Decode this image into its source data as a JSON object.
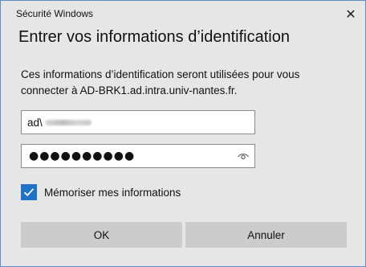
{
  "window": {
    "title": "Sécurité Windows",
    "close_glyph": "✕"
  },
  "dialog": {
    "heading": "Entrer vos informations d’identification",
    "description": "Ces informations d’identification seront utilisées pour vous connecter à AD-BRK1.ad.intra.univ-nantes.fr."
  },
  "username_field": {
    "value_prefix": "ad\\",
    "value_obscured": true
  },
  "password_field": {
    "masked_value": "●●●●●●●●●●",
    "reveal_icon": "eye-icon"
  },
  "remember_checkbox": {
    "label": "Mémoriser mes informations",
    "checked": true
  },
  "buttons": {
    "ok_label": "OK",
    "cancel_label": "Annuler"
  },
  "colors": {
    "accent": "#1e73c8",
    "dialog_background": "#e6e6e6",
    "button_background": "#cccccc",
    "border": "#5f8fc0"
  }
}
